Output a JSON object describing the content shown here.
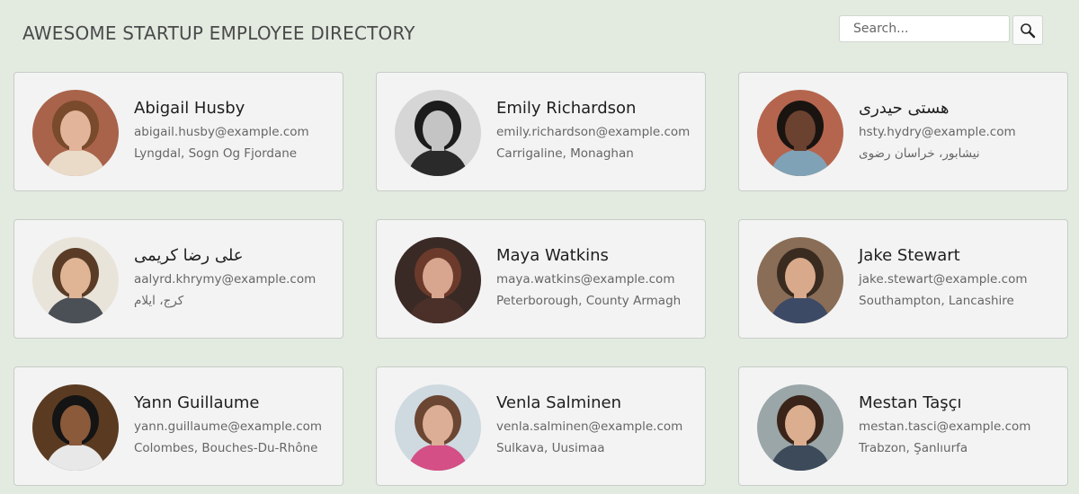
{
  "header": {
    "title": "AWESOME STARTUP EMPLOYEE DIRECTORY",
    "search_placeholder": "Search...",
    "search_icon": "magnifier-icon"
  },
  "employees": [
    {
      "name": "Abigail Husby",
      "email": "abigail.husby@example.com",
      "location": "Lyngdal, Sogn Og Fjordane",
      "colors": {
        "bg": "#a8634a",
        "skin": "#e2b49a",
        "hair": "#7a4a2c",
        "shirt": "#eadbc8"
      }
    },
    {
      "name": "Emily Richardson",
      "email": "emily.richardson@example.com",
      "location": "Carrigaline, Monaghan",
      "colors": {
        "bg": "#d6d6d6",
        "skin": "#c4c4c4",
        "hair": "#1c1c1c",
        "shirt": "#2a2a2a"
      }
    },
    {
      "name": "هستی حیدری",
      "email": "hsty.hydry@example.com",
      "location": "نیشابور، خراسان رضوی",
      "colors": {
        "bg": "#b5654e",
        "skin": "#6b4130",
        "hair": "#1a1411",
        "shirt": "#7fa2b6"
      }
    },
    {
      "name": "علی رضا كريمی",
      "email": "aalyrd.khrymy@example.com",
      "location": "کرج، ایلام",
      "colors": {
        "bg": "#e9e4da",
        "skin": "#e0b596",
        "hair": "#5a3c26",
        "shirt": "#4b4f56"
      }
    },
    {
      "name": "Maya Watkins",
      "email": "maya.watkins@example.com",
      "location": "Peterborough, County Armagh",
      "colors": {
        "bg": "#3a2a25",
        "skin": "#d8a58f",
        "hair": "#6b3a2b",
        "shirt": "#4a3029"
      }
    },
    {
      "name": "Jake Stewart",
      "email": "jake.stewart@example.com",
      "location": "Southampton, Lancashire",
      "colors": {
        "bg": "#8a6d56",
        "skin": "#d9a98c",
        "hair": "#3a2b20",
        "shirt": "#3d4a66"
      }
    },
    {
      "name": "Yann Guillaume",
      "email": "yann.guillaume@example.com",
      "location": "Colombes, Bouches-Du-Rhône",
      "colors": {
        "bg": "#5a3b22",
        "skin": "#8a5a3a",
        "hair": "#141414",
        "shirt": "#e8e8e8"
      }
    },
    {
      "name": "Venla Salminen",
      "email": "venla.salminen@example.com",
      "location": "Sulkava, Uusimaa",
      "colors": {
        "bg": "#cfd9e0",
        "skin": "#dcae95",
        "hair": "#6b4632",
        "shirt": "#d34f86"
      }
    },
    {
      "name": "Mestan Taşçı",
      "email": "mestan.tasci@example.com",
      "location": "Trabzon, Şanlıurfa",
      "colors": {
        "bg": "#9aa6a8",
        "skin": "#dcae90",
        "hair": "#3a241a",
        "shirt": "#3c4a5a"
      }
    }
  ]
}
